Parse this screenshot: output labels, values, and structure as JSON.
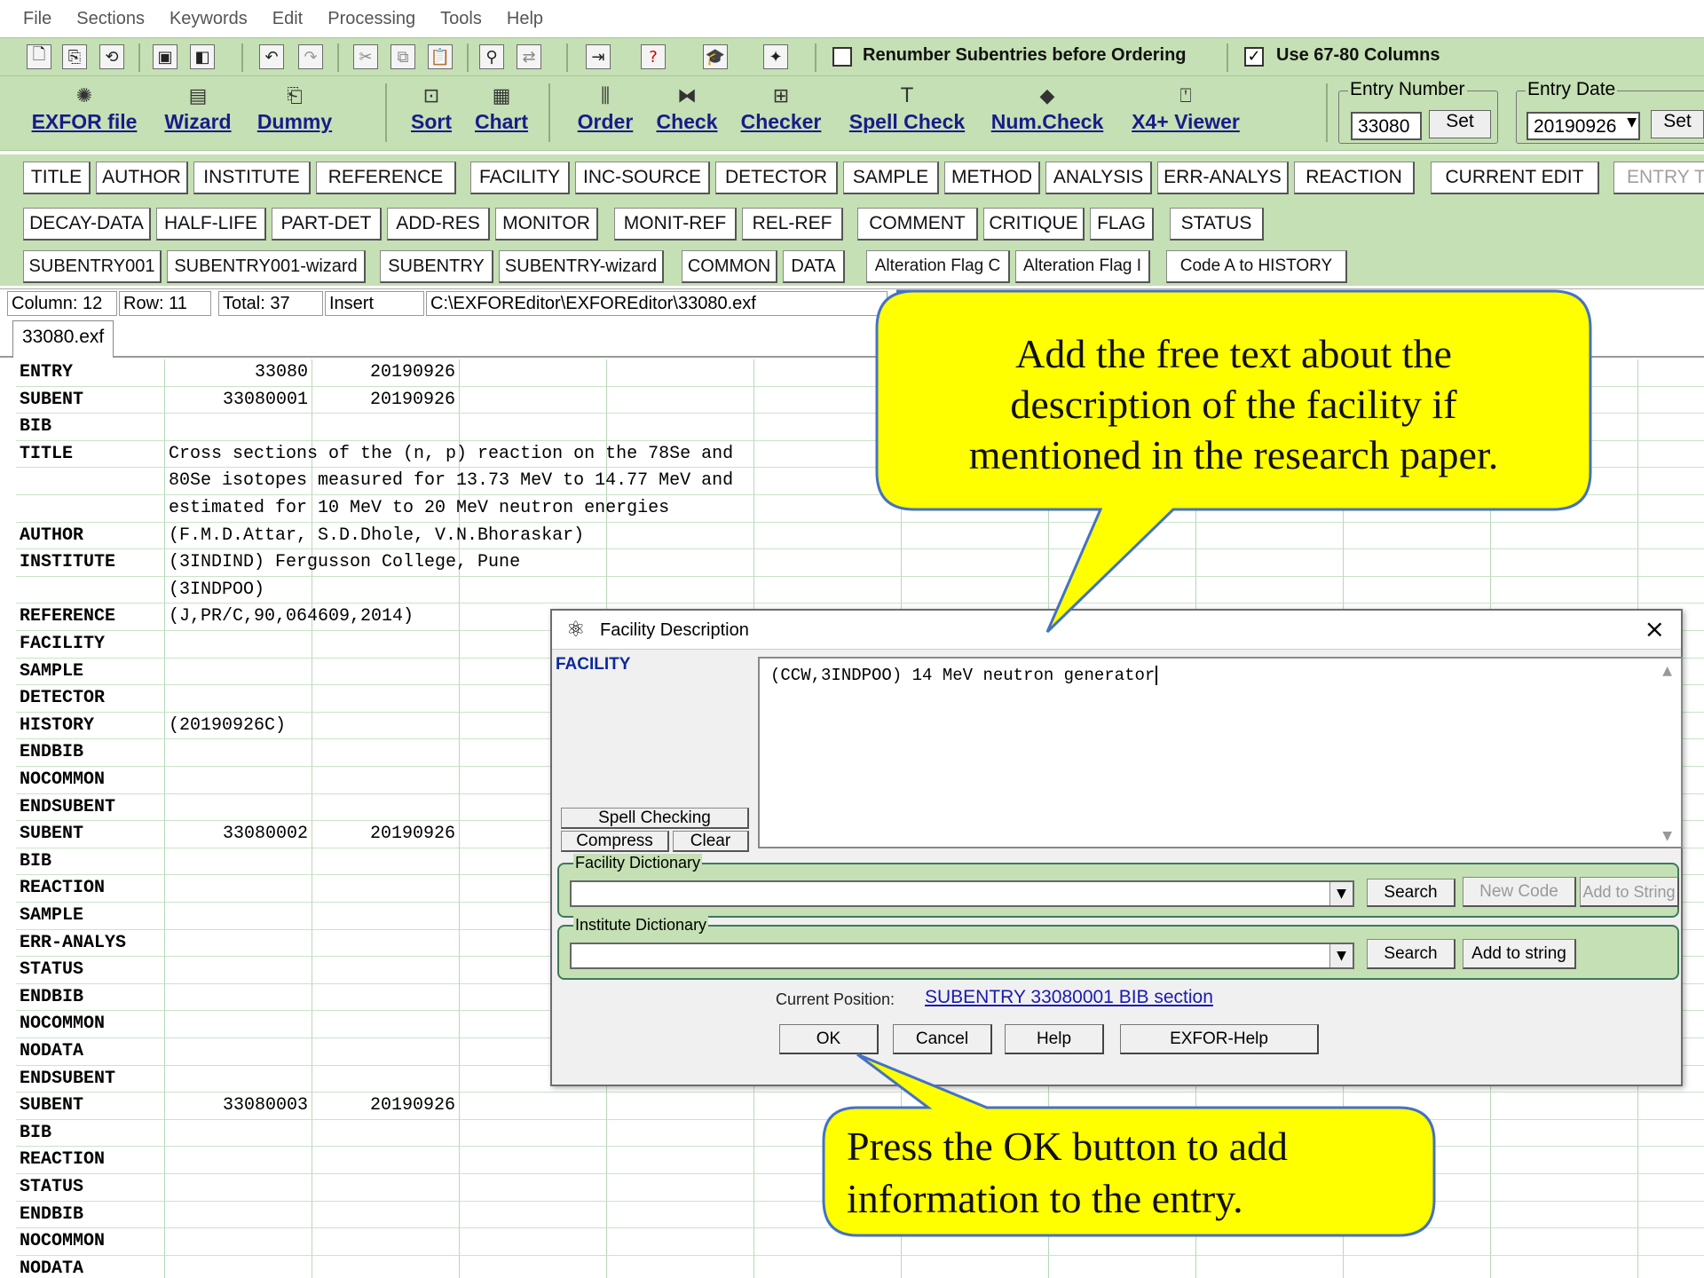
{
  "menu": [
    "File",
    "Sections",
    "Keywords",
    "Edit",
    "Processing",
    "Tools",
    "Help"
  ],
  "toolbar1": {
    "icons": [
      "new-file-icon",
      "open-icon",
      "open-recent-icon",
      "save-icon",
      "save-all-icon",
      "undo-icon",
      "redo-icon",
      "cut-icon",
      "copy-icon",
      "paste-icon",
      "find-icon",
      "replace-icon",
      "exit-icon",
      "help-icon",
      "hat-icon",
      "wizard-icon"
    ],
    "renumber_label": "Renumber Subentries before Ordering",
    "renumber_checked": "",
    "use_columns_label": "Use 67-80  Columns",
    "use_columns_checked": "✓"
  },
  "toolbar2": {
    "buttons": [
      "EXFOR file",
      "Wizard",
      "Dummy",
      "Sort",
      "Chart",
      "Order",
      "Check",
      "Checker",
      "Spell Check",
      "Num.Check",
      "X4+ Viewer"
    ],
    "entry_number_label": "Entry Number",
    "entry_number_value": "33080",
    "set_label": "Set",
    "entry_date_label": "Entry Date",
    "entry_date_value": "20190926",
    "set2_label": "Set"
  },
  "rows": {
    "row1": [
      "TITLE",
      "AUTHOR",
      "INSTITUTE",
      "REFERENCE",
      "FACILITY",
      "INC-SOURCE",
      "DETECTOR",
      "SAMPLE",
      "METHOD",
      "ANALYSIS",
      "ERR-ANALYS",
      "REACTION",
      "CURRENT EDIT",
      "ENTRY T"
    ],
    "row2": [
      "DECAY-DATA",
      "HALF-LIFE",
      "PART-DET",
      "ADD-RES",
      "MONITOR",
      "MONIT-REF",
      "REL-REF",
      "COMMENT",
      "CRITIQUE",
      "FLAG",
      "STATUS"
    ],
    "row3": [
      "SUBENTRY001",
      "SUBENTRY001-wizard",
      "SUBENTRY",
      "SUBENTRY-wizard",
      "COMMON",
      "DATA",
      "Alteration Flag C",
      "Alteration Flag I",
      "Code A to HISTORY"
    ]
  },
  "status": {
    "column": "Column: 12",
    "row": "Row: 11",
    "total": "Total: 37",
    "mode": "Insert",
    "path": "C:\\EXFOREditor\\EXFOREditor\\33080.exf"
  },
  "tab": "33080.exf",
  "grid": [
    [
      "ENTRY",
      "33080",
      "20190926"
    ],
    [
      "SUBENT",
      "33080001",
      "20190926"
    ],
    [
      "BIB",
      "",
      ""
    ],
    [
      "TITLE",
      "Cross sections of the (n, p) reaction on the 78Se and",
      ""
    ],
    [
      "",
      "80Se isotopes measured for 13.73 MeV to 14.77 MeV and",
      ""
    ],
    [
      "",
      "estimated for 10 MeV to 20 MeV neutron energies",
      ""
    ],
    [
      "AUTHOR",
      "(F.M.D.Attar, S.D.Dhole, V.N.Bhoraskar)",
      ""
    ],
    [
      "INSTITUTE",
      "(3INDIND) Fergusson College, Pune",
      ""
    ],
    [
      "",
      "(3INDPOO)",
      ""
    ],
    [
      "REFERENCE",
      "(J,PR/C,90,064609,2014)",
      ""
    ],
    [
      "FACILITY",
      "",
      ""
    ],
    [
      "SAMPLE",
      "",
      ""
    ],
    [
      "DETECTOR",
      "",
      ""
    ],
    [
      "HISTORY",
      "(20190926C)",
      ""
    ],
    [
      "ENDBIB",
      "",
      ""
    ],
    [
      "NOCOMMON",
      "",
      ""
    ],
    [
      "ENDSUBENT",
      "",
      ""
    ],
    [
      "SUBENT",
      "33080002",
      "20190926"
    ],
    [
      "BIB",
      "",
      ""
    ],
    [
      "REACTION",
      "",
      ""
    ],
    [
      "SAMPLE",
      "",
      ""
    ],
    [
      "ERR-ANALYS",
      "",
      ""
    ],
    [
      "STATUS",
      "",
      ""
    ],
    [
      "ENDBIB",
      "",
      ""
    ],
    [
      "NOCOMMON",
      "",
      ""
    ],
    [
      "NODATA",
      "",
      ""
    ],
    [
      "ENDSUBENT",
      "",
      ""
    ],
    [
      "SUBENT",
      "33080003",
      "20190926"
    ],
    [
      "BIB",
      "",
      ""
    ],
    [
      "REACTION",
      "",
      ""
    ],
    [
      "STATUS",
      "",
      ""
    ],
    [
      "ENDBIB",
      "",
      ""
    ],
    [
      "NOCOMMON",
      "",
      ""
    ],
    [
      "NODATA",
      "",
      ""
    ]
  ],
  "dialog": {
    "title": "Facility Description",
    "close": "×",
    "section_label": "FACILITY",
    "text": "(CCW,3INDPOO) 14 MeV neutron generator",
    "spell_checking": "Spell Checking",
    "compress": "Compress",
    "clear": "Clear",
    "facility_dict_label": "Facility Dictionary",
    "institute_dict_label": "Institute Dictionary",
    "search": "Search",
    "new_code": "New Code",
    "add_to_string": "Add to String",
    "add_to_string2": "Add to string",
    "current_position_label": "Current Position:",
    "current_position_value": "SUBENTRY 33080001  BIB section",
    "ok": "OK",
    "cancel": "Cancel",
    "help": "Help",
    "exfor_help": "EXFOR-Help"
  },
  "callouts": {
    "top": [
      "Add the free text about the",
      "description of the facility if",
      "mentioned in the research paper."
    ],
    "bottom": [
      "Press the OK button to add",
      "information to the entry."
    ]
  },
  "colors": {
    "toolbar_green": "#c5e0b4",
    "callout_yellow": "#ffff00",
    "callout_border": "#4472c4",
    "link_blue": "#1a1ab0"
  }
}
